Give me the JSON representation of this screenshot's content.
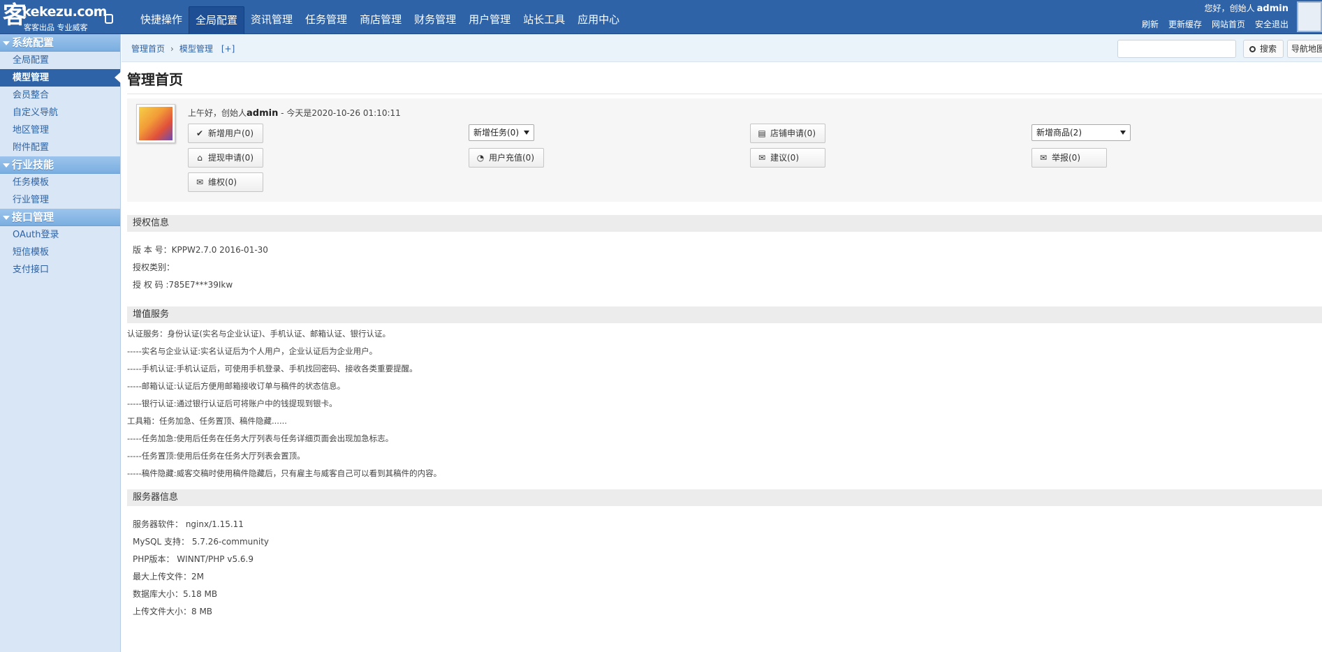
{
  "brand": {
    "logo_glyph": "客",
    "logo_text": "kekezu.com",
    "logo_sub": "客客出品 专业威客"
  },
  "topnav": {
    "items": [
      {
        "label": "快捷操作"
      },
      {
        "label": "全局配置"
      },
      {
        "label": "资讯管理"
      },
      {
        "label": "任务管理"
      },
      {
        "label": "商店管理"
      },
      {
        "label": "财务管理"
      },
      {
        "label": "用户管理"
      },
      {
        "label": "站长工具"
      },
      {
        "label": "应用中心"
      }
    ]
  },
  "user": {
    "greeting": "您好，创始人",
    "name": "admin",
    "links": [
      "刷新",
      "更新缓存",
      "网站首页",
      "安全退出"
    ]
  },
  "sidebar": {
    "groups": [
      {
        "title": "系统配置",
        "items": [
          "全局配置",
          "模型管理",
          "会员整合",
          "自定义导航",
          "地区管理",
          "附件配置"
        ]
      },
      {
        "title": "行业技能",
        "items": [
          "任务模板",
          "行业管理"
        ]
      },
      {
        "title": "接口管理",
        "items": [
          "OAuth登录",
          "短信模板",
          "支付接口"
        ]
      }
    ]
  },
  "breadcrumb": {
    "home": "管理首页",
    "current": "模型管理",
    "plus": "[+]"
  },
  "search": {
    "placeholder": "",
    "button": "搜索",
    "sitemap": "导航地图"
  },
  "page": {
    "title": "管理首页"
  },
  "welcome": {
    "prefix": "上午好，创始人",
    "name": "admin",
    "suffix": " - 今天是2020-10-26 01:10:11"
  },
  "quick": {
    "new_user": "新增用户(0)",
    "new_task": "新增任务(0)",
    "shop_apply": "店铺申请(0)",
    "new_goods": "新增商品(2)",
    "withdraw": "提现申请(0)",
    "recharge": "用户充值(0)",
    "suggest": "建议(0)",
    "report": "举报(0)",
    "rights": "维权(0)"
  },
  "license": {
    "title": "授权信息",
    "lines": [
      "版 本 号：KPPW2.7.0 2016-01-30",
      "授权类别：",
      "授 权 码 :785E7***39Ikw"
    ]
  },
  "services": {
    "title": "增值服务",
    "lines": [
      "认证服务：身份认证(实名与企业认证)、手机认证、邮箱认证、银行认证。",
      "-----实名与企业认证:实名认证后为个人用户，企业认证后为企业用户。",
      "-----手机认证:手机认证后，可使用手机登录、手机找回密码、接收各类重要提醒。",
      "-----邮箱认证:认证后方便用邮箱接收订单与稿件的状态信息。",
      "-----银行认证:通过银行认证后可将账户中的钱提现到银卡。",
      "工具箱：任务加急、任务置顶、稿件隐藏......",
      "-----任务加急:使用后任务在任务大厅列表与任务详细页面会出现加急标志。",
      "-----任务置顶:使用后任务在任务大厅列表会置顶。",
      "-----稿件隐藏:威客交稿时使用稿件隐藏后，只有雇主与威客自己可以看到其稿件的内容。"
    ]
  },
  "server": {
    "title": "服务器信息",
    "lines": [
      "服务器软件： nginx/1.15.11",
      "MySQL 支持： 5.7.26-community",
      "PHP版本： WINNT/PHP v5.6.9",
      "最大上传文件：2M",
      "数据库大小：5.18 MB",
      "上传文件大小：8 MB"
    ]
  },
  "colors": {
    "topbar": "#2e63a8",
    "sidebar": "#d8e6f5",
    "link": "#2e62a5"
  },
  "icons": {
    "new_user": "check-icon",
    "shop_apply": "document-icon",
    "withdraw": "home-icon",
    "recharge": "rss-icon",
    "suggest": "envelope-icon",
    "report": "envelope-icon",
    "rights": "envelope-icon"
  }
}
